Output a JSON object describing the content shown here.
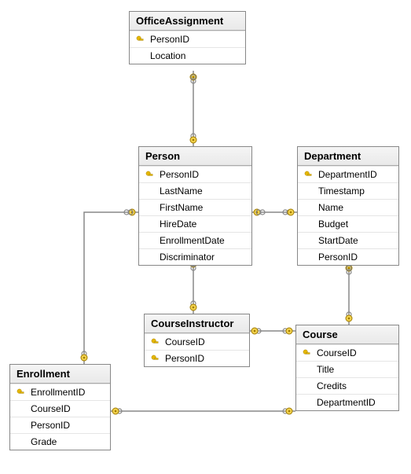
{
  "tables": {
    "office_assignment": {
      "name": "OfficeAssignment",
      "columns": [
        {
          "name": "PersonID",
          "pk": true
        },
        {
          "name": "Location",
          "pk": false
        }
      ]
    },
    "person": {
      "name": "Person",
      "columns": [
        {
          "name": "PersonID",
          "pk": true
        },
        {
          "name": "LastName",
          "pk": false
        },
        {
          "name": "FirstName",
          "pk": false
        },
        {
          "name": "HireDate",
          "pk": false
        },
        {
          "name": "EnrollmentDate",
          "pk": false
        },
        {
          "name": "Discriminator",
          "pk": false
        }
      ]
    },
    "department": {
      "name": "Department",
      "columns": [
        {
          "name": "DepartmentID",
          "pk": true
        },
        {
          "name": "Timestamp",
          "pk": false
        },
        {
          "name": "Name",
          "pk": false
        },
        {
          "name": "Budget",
          "pk": false
        },
        {
          "name": "StartDate",
          "pk": false
        },
        {
          "name": "PersonID",
          "pk": false
        }
      ]
    },
    "course_instructor": {
      "name": "CourseInstructor",
      "columns": [
        {
          "name": "CourseID",
          "pk": true
        },
        {
          "name": "PersonID",
          "pk": true
        }
      ]
    },
    "course": {
      "name": "Course",
      "columns": [
        {
          "name": "CourseID",
          "pk": true
        },
        {
          "name": "Title",
          "pk": false
        },
        {
          "name": "Credits",
          "pk": false
        },
        {
          "name": "DepartmentID",
          "pk": false
        }
      ]
    },
    "enrollment": {
      "name": "Enrollment",
      "columns": [
        {
          "name": "EnrollmentID",
          "pk": true
        },
        {
          "name": "CourseID",
          "pk": false
        },
        {
          "name": "PersonID",
          "pk": false
        },
        {
          "name": "Grade",
          "pk": false
        }
      ]
    }
  },
  "relationships": [
    {
      "from": "OfficeAssignment",
      "to": "Person"
    },
    {
      "from": "Person",
      "to": "Department"
    },
    {
      "from": "Person",
      "to": "Enrollment"
    },
    {
      "from": "Person",
      "to": "CourseInstructor"
    },
    {
      "from": "Department",
      "to": "Course"
    },
    {
      "from": "CourseInstructor",
      "to": "Course"
    },
    {
      "from": "Enrollment",
      "to": "Course"
    }
  ]
}
